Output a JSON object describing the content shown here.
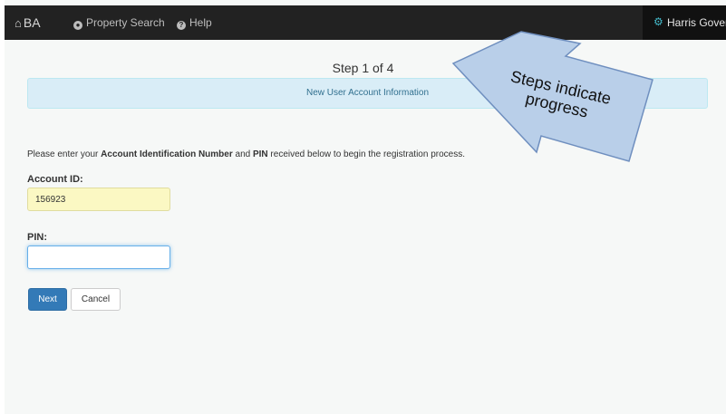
{
  "navbar": {
    "brand": "BA",
    "links": [
      {
        "label": "Property Search",
        "icon": "globe-icon"
      },
      {
        "label": "Help",
        "icon": "question-circle-icon"
      }
    ],
    "user": "Harris Govern"
  },
  "step": {
    "title": "Step 1 of 4",
    "section": "New User Account Information"
  },
  "form": {
    "instructions_pre": "Please enter your ",
    "instructions_bold1": "Account Identification Number",
    "instructions_mid": " and ",
    "instructions_bold2": "PIN",
    "instructions_post": " received below to begin the registration process.",
    "account_label": "Account ID:",
    "account_value": "156923",
    "pin_label": "PIN:",
    "pin_value": ""
  },
  "buttons": {
    "next": "Next",
    "cancel": "Cancel"
  },
  "callout": {
    "line1": "Steps indicate",
    "line2": "progress"
  },
  "colors": {
    "navbar": "#222222",
    "info_bar": "#d9edf7",
    "primary": "#337ab7",
    "account_field_highlight": "#fbf8c3"
  }
}
